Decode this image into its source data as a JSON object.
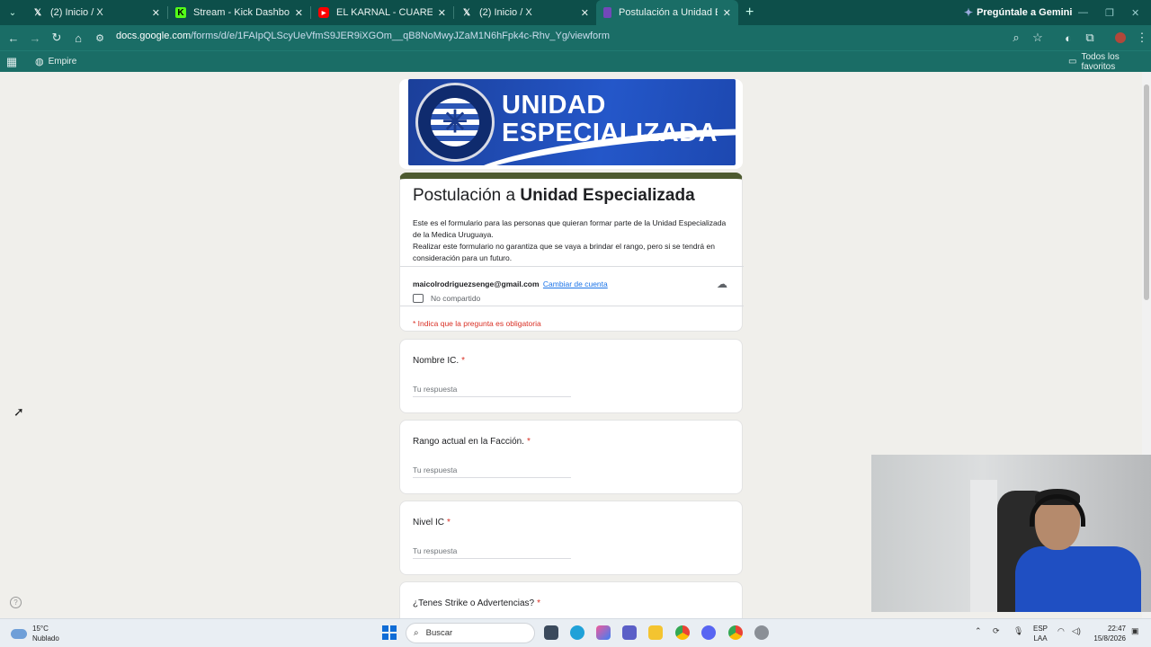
{
  "tabs": [
    {
      "title": "(2) Inicio / X",
      "icon": "x-icon",
      "active": false
    },
    {
      "title": "Stream - Kick Dashboard",
      "icon": "kick-icon",
      "active": false
    },
    {
      "title": "EL KARNAL - CUAREIM (EnLaPe",
      "icon": "youtube-icon",
      "active": false
    },
    {
      "title": "(2) Inicio / X",
      "icon": "x-icon",
      "active": false
    },
    {
      "title": "Postulación a Unidad Especializ",
      "icon": "forms-icon",
      "active": true
    }
  ],
  "gemini_label": "Pregúntale a Gemini",
  "url": {
    "host": "docs.google.com",
    "path": "/forms/d/e/1FAIpQLScyUeVfmS9JER9iXGOm__qB8NoMwyJZaM1N6hFpk4c-Rhv_Yg/viewform"
  },
  "bookmarks": {
    "item": "Empire",
    "all": "Todos los favoritos"
  },
  "banner": {
    "line1": "UNIDAD",
    "line2": "ESPECIALIZADA",
    "seal_text": "MEDICA URUGUAYA"
  },
  "form": {
    "title_prefix": "Postulación a ",
    "title_bold": "Unidad Especializada",
    "description_1": "Este es el formulario para las personas que quieran formar parte de la Unidad Especializada de la Medica Uruguaya.",
    "description_2": "Realizar este formulario no garantiza que se vaya a brindar el rango, pero si se tendrá en consideración para un futuro.",
    "account_email": "maicolrodriguezsenge@gmail.com",
    "switch_account": "Cambiar de cuenta",
    "not_shared": "No compartido",
    "required_note": "* Indica que la pregunta es obligatoria",
    "questions": [
      {
        "label": "Nombre IC.",
        "required": "*",
        "placeholder": "Tu respuesta"
      },
      {
        "label": "Rango actual en la Facción.",
        "required": "*",
        "placeholder": "Tu respuesta"
      },
      {
        "label": "Nivel IC",
        "required": "*",
        "placeholder": "Tu respuesta"
      },
      {
        "label": "¿Tenes Strike o Advertencias?",
        "required": "*"
      }
    ]
  },
  "taskbar": {
    "temperature": "15°C",
    "weather": "Nublado",
    "search": "Buscar",
    "lang_1": "ESP",
    "lang_2": "LAA",
    "time": "22:47",
    "date": "15/8/2026"
  },
  "colors": {
    "tabstrip": "#0d4f4a",
    "toolbar": "#1a6d66",
    "form_accent": "#4d5a2f",
    "required": "#d93025",
    "link": "#1a73e8"
  }
}
